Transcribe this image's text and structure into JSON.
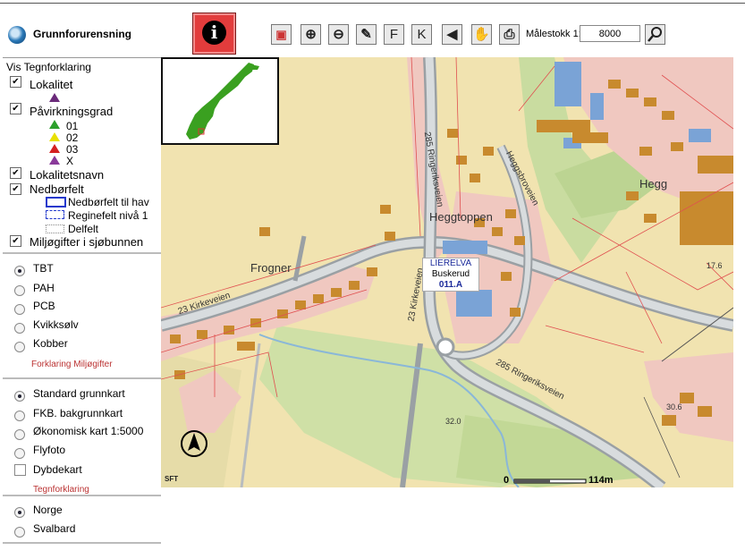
{
  "app": {
    "title": "Grunnforurensning"
  },
  "toolbar": {
    "info_glyph": "i",
    "tools": [
      {
        "name": "extent-tool",
        "glyph": "▣"
      },
      {
        "name": "zoom-in-tool",
        "glyph": "⊕"
      },
      {
        "name": "zoom-out-tool",
        "glyph": "⊖"
      },
      {
        "name": "draw-tool",
        "glyph": "✎"
      },
      {
        "name": "f-tool",
        "glyph": "F"
      },
      {
        "name": "k-tool",
        "glyph": "K"
      },
      {
        "name": "back-tool",
        "glyph": "◀"
      },
      {
        "name": "pan-tool",
        "glyph": "✋"
      },
      {
        "name": "print-tool",
        "glyph": "⎙"
      }
    ],
    "scale_label": "Målestokk 1:",
    "scale_value": "8000"
  },
  "legend": {
    "header": "Vis Tegnforklaring",
    "lokalitet": "Lokalitet",
    "pavirkningsgrad": "Påvirkningsgrad",
    "grades": [
      "01",
      "02",
      "03",
      "X"
    ],
    "lokalitetsnavn": "Lokalitetsnavn",
    "nedborfelt": "Nedbørfelt",
    "nedborfelt_items": [
      "Nedbørfelt til hav",
      "Reginefelt nivå 1",
      "Delfelt"
    ],
    "miljogifter": "Miljøgifter i sjøbunnen"
  },
  "toxins": {
    "options": [
      "TBT",
      "PAH",
      "PCB",
      "Kvikksølv",
      "Kobber"
    ],
    "selected": 0,
    "link": "Forklaring Miljøgifter"
  },
  "basemaps": {
    "options": [
      "Standard grunnkart",
      "FKB. bakgrunnkart",
      "Økonomisk kart 1:5000",
      "Flyfoto"
    ],
    "selected": 0,
    "depth_label": "Dybdekart",
    "link": "Tegnforklaring"
  },
  "regions": {
    "options": [
      "Norge",
      "Svalbard"
    ],
    "selected": 0
  },
  "map": {
    "labels": {
      "frogner": "Frogner",
      "hegg": "Hegg",
      "heggtoppen": "Heggtoppen",
      "kirkeveien": "23 Kirkeveien",
      "kirkeveien2": "23 Kirkeveien",
      "ringeriksveien_top": "285 Ringeriksveien",
      "ringeriksveien_bottom": "285 Ringeriksveien",
      "heggsbroveien": "Heggsbroveien",
      "elev1": "17.6",
      "elev2": "30.6",
      "elev3": "32.0",
      "site_name": "LIERELVA",
      "site_county": "Buskerud",
      "site_code": "011.A",
      "copyright": "SFT"
    },
    "scalebar_start": "0",
    "scalebar_end": "114m"
  }
}
